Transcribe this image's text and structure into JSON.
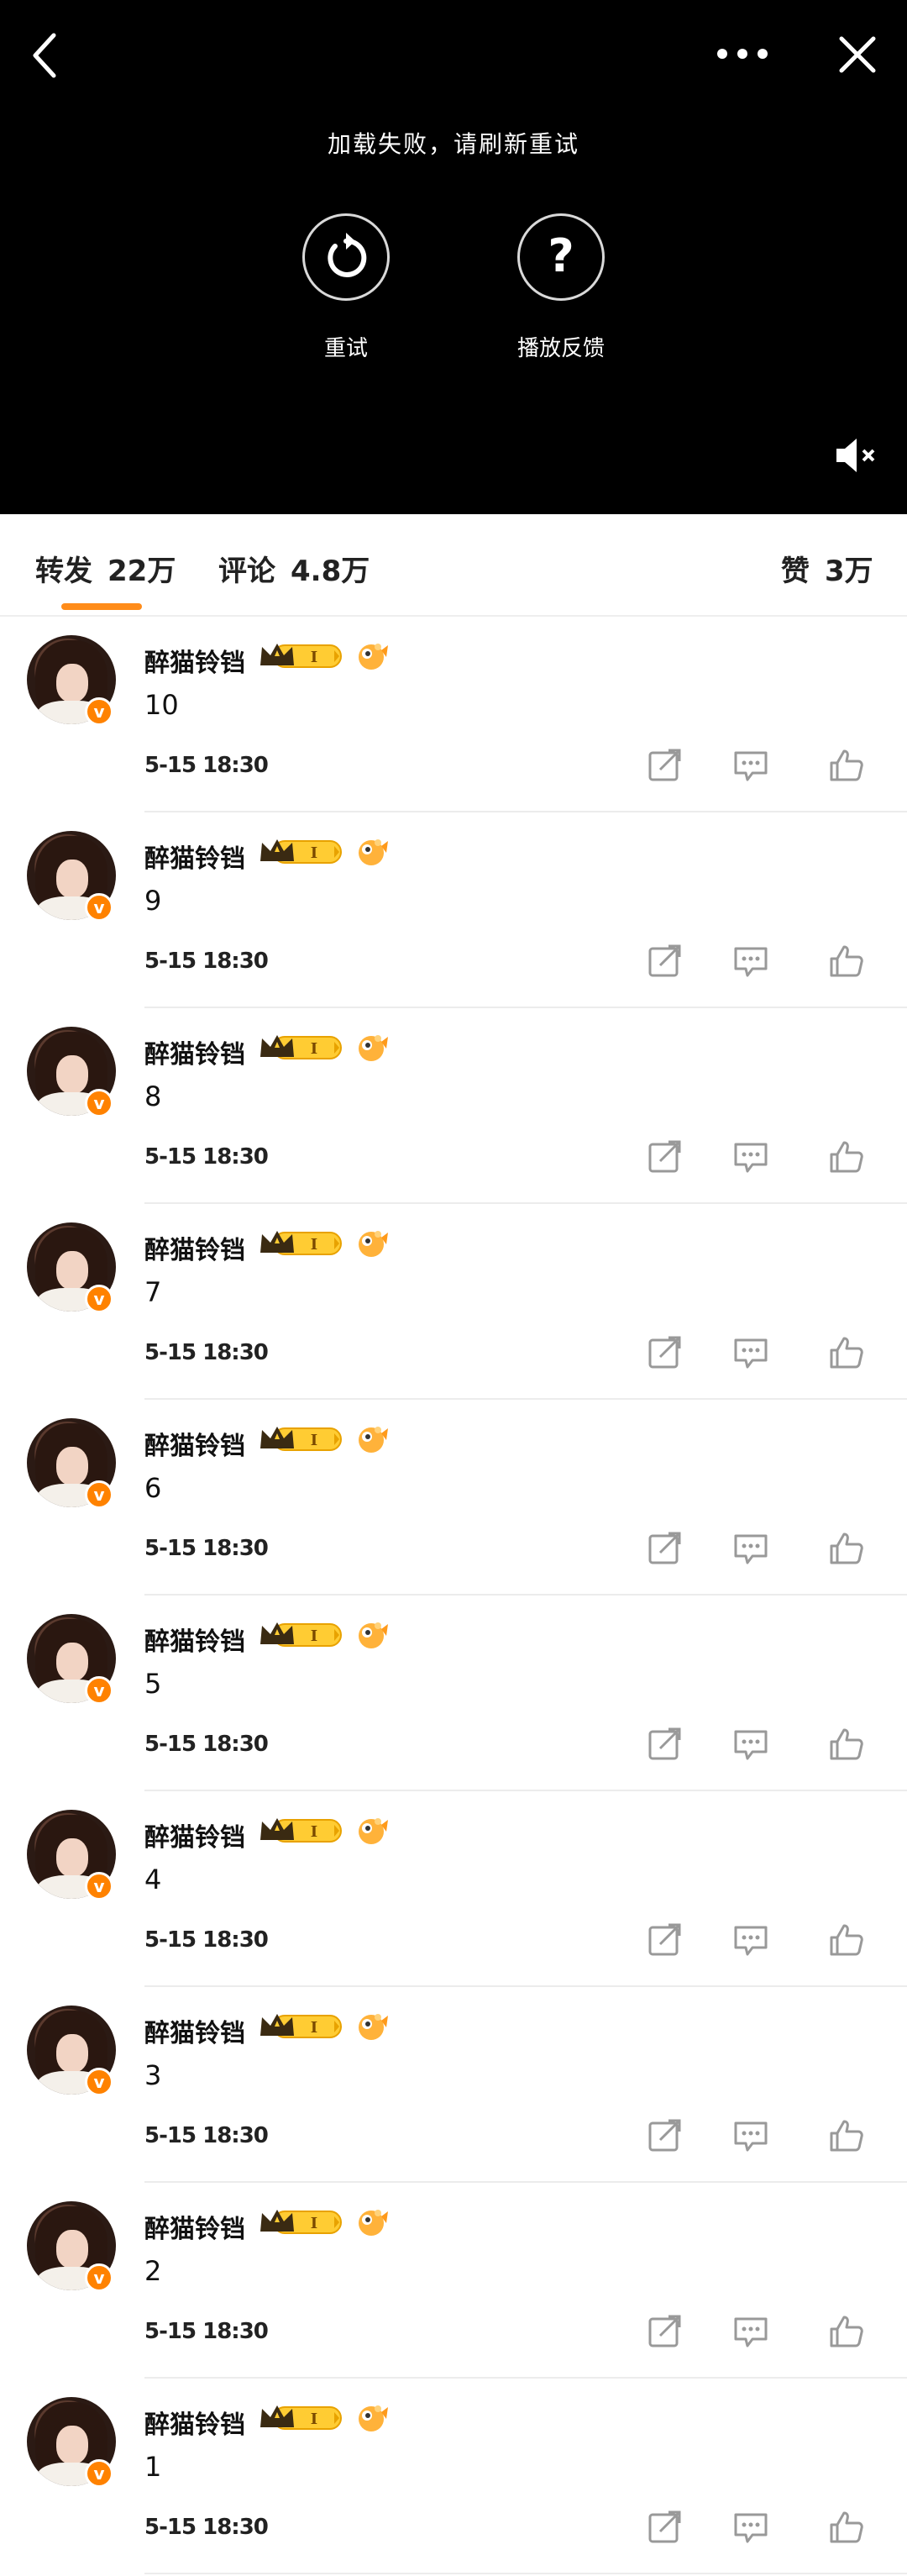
{
  "player": {
    "error_message": "加载失败，请刷新重试",
    "retry_label": "重试",
    "feedback_label": "播放反馈",
    "icons": [
      "back-icon",
      "more-icon",
      "close-icon",
      "retry-icon",
      "help-icon",
      "mute-icon"
    ]
  },
  "tabs": [
    {
      "label": "转发",
      "count": "22万"
    },
    {
      "label": "评论",
      "count": "4.8万"
    },
    {
      "label": "赞",
      "count": "3万"
    }
  ],
  "accent_color": "#ff8c1a",
  "repost_items": [
    {
      "user": "醉猫铃铛",
      "text": "10",
      "time": "5-15  18:30"
    },
    {
      "user": "醉猫铃铛",
      "text": "9",
      "time": "5-15  18:30"
    },
    {
      "user": "醉猫铃铛",
      "text": "8",
      "time": "5-15  18:30"
    },
    {
      "user": "醉猫铃铛",
      "text": "7",
      "time": "5-15  18:30"
    },
    {
      "user": "醉猫铃铛",
      "text": "6",
      "time": "5-15  18:30"
    },
    {
      "user": "醉猫铃铛",
      "text": "5",
      "time": "5-15  18:30"
    },
    {
      "user": "醉猫铃铛",
      "text": "4",
      "time": "5-15  18:30"
    },
    {
      "user": "醉猫铃铛",
      "text": "3",
      "time": "5-15  18:30"
    },
    {
      "user": "醉猫铃铛",
      "text": "2",
      "time": "5-15  18:30"
    },
    {
      "user": "醉猫铃铛",
      "text": "1",
      "time": "5-15  18:30"
    }
  ]
}
